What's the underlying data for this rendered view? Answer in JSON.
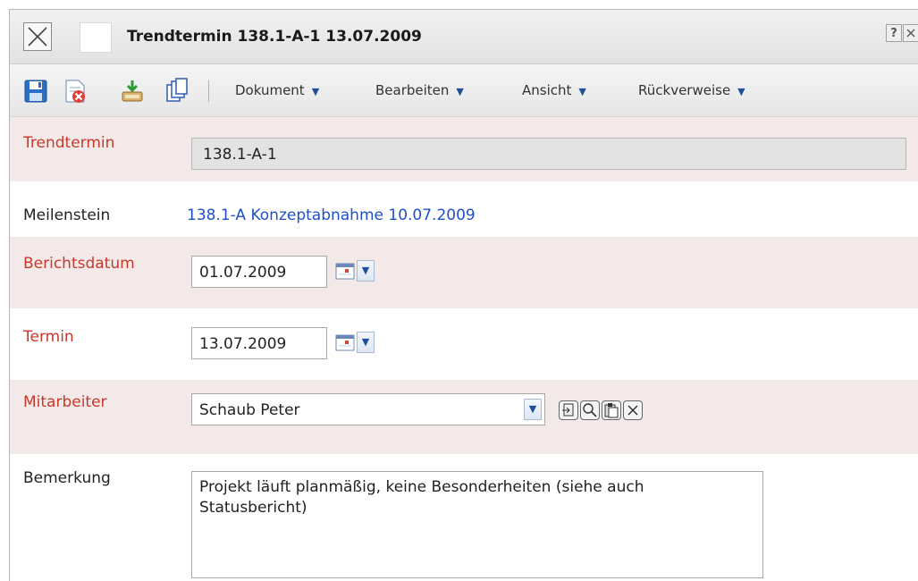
{
  "window": {
    "title": "Trendtermin 138.1-A-1 13.07.2009",
    "help_button": "?"
  },
  "toolbar": {
    "icons": [
      "save-icon",
      "delete-icon",
      "export-icon",
      "copy-icon"
    ],
    "menus": [
      {
        "label": "Dokument"
      },
      {
        "label": "Bearbeiten"
      },
      {
        "label": "Ansicht"
      },
      {
        "label": "Rückverweise"
      }
    ]
  },
  "form": {
    "trendtermin": {
      "label": "Trendtermin",
      "value": "138.1-A-1"
    },
    "meilenstein": {
      "label": "Meilenstein",
      "value": "138.1-A Konzeptabnahme 10.07.2009"
    },
    "berichtsdatum": {
      "label": "Berichtsdatum",
      "value": "01.07.2009"
    },
    "termin": {
      "label": "Termin",
      "value": "13.07.2009"
    },
    "mitarbeiter": {
      "label": "Mitarbeiter",
      "value": "Schaub Peter"
    },
    "bemerkung": {
      "label": "Bemerkung",
      "value": "Projekt läuft planmäßig, keine Besonderheiten (siehe auch Statusbericht)"
    }
  },
  "colors": {
    "required_label": "#c8392b",
    "link": "#1f4fc8",
    "row_shade": "#f3e9e9"
  }
}
